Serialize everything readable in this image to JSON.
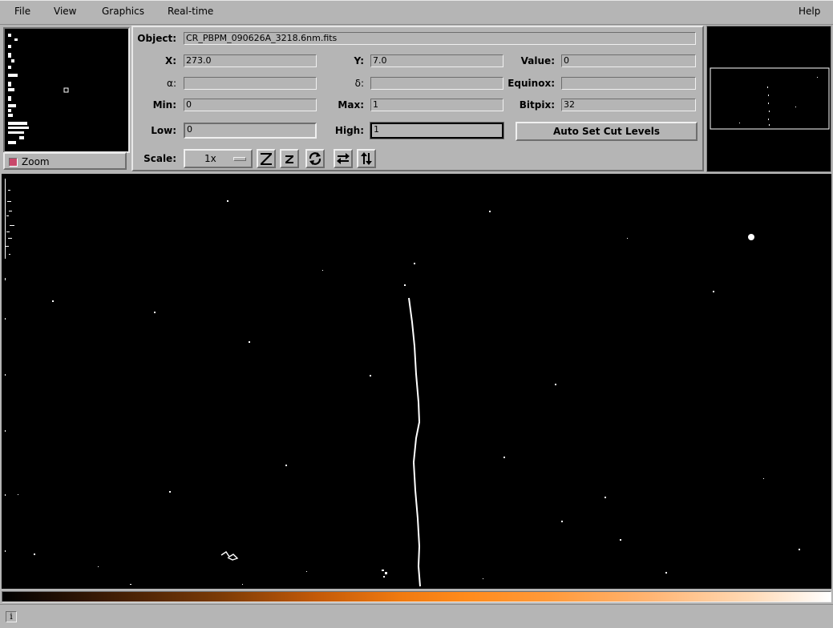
{
  "menu": {
    "file": "File",
    "view": "View",
    "graphics": "Graphics",
    "realtime": "Real-time",
    "help": "Help"
  },
  "zoom": {
    "label": "Zoom"
  },
  "info": {
    "object_label": "Object:",
    "object_value": "CR_PBPM_090626A_3218.6nm.fits",
    "x_label": "X:",
    "x_value": "273.0",
    "y_label": "Y:",
    "y_value": "7.0",
    "value_label": "Value:",
    "value_value": "0",
    "alpha_label": "α:",
    "alpha_value": "",
    "delta_label": "δ:",
    "delta_value": "",
    "equinox_label": "Equinox:",
    "equinox_value": "",
    "min_label": "Min:",
    "min_value": "0",
    "max_label": "Max:",
    "max_value": "1",
    "bitpix_label": "Bitpix:",
    "bitpix_value": "32",
    "low_label": "Low:",
    "low_value": "0",
    "high_label": "High:",
    "high_value": "1",
    "auto_cut_label": "Auto Set Cut Levels",
    "scale_label": "Scale:",
    "scale_value": "1x"
  },
  "toolbar_icons": [
    "zoom-in-icon",
    "zoom-out-icon",
    "rotate-icon",
    "flip-horizontal-icon",
    "flip-vertical-icon"
  ],
  "colors": {
    "panel": "#b5b5b5",
    "image_bg": "#000000",
    "colormap_mid": "#ff8b1c",
    "zoom_indicator": "#c8486a"
  },
  "status": {
    "icon": "i"
  }
}
